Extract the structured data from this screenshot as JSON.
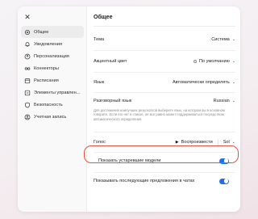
{
  "sidebar": {
    "close_icon": "close-icon",
    "items": [
      {
        "label": "Общее",
        "icon": "gear-icon",
        "active": true
      },
      {
        "label": "Уведомления",
        "icon": "bell-icon"
      },
      {
        "label": "Персонализация",
        "icon": "person-icon"
      },
      {
        "label": "Коннекторы",
        "icon": "connector-icon"
      },
      {
        "label": "Расписания",
        "icon": "calendar-icon"
      },
      {
        "label": "Элементы управлен...",
        "icon": "controls-icon"
      },
      {
        "label": "Безопасность",
        "icon": "shield-icon"
      },
      {
        "label": "Учетная запись",
        "icon": "account-icon"
      }
    ]
  },
  "main": {
    "title": "Общее",
    "theme": {
      "label": "Тема",
      "value": "Система"
    },
    "accent": {
      "label": "Акцентный цвет",
      "value": "По умолчанию"
    },
    "language": {
      "label": "Язык",
      "value": "Автоматически определять"
    },
    "spoken": {
      "label": "Разговорный язык",
      "value": "Russian",
      "description": "Для достижения наилучших результатов выберите язык, на котором вы в основном говорите. Если его нет в списке, он все равно может поддерживаться посредством автоматического определения."
    },
    "voice": {
      "label": "Голос",
      "play_label": "Воспроизвести",
      "value": "Sol"
    },
    "legacy_models": {
      "label": "Показать устаревшие модели",
      "enabled": true
    },
    "followups": {
      "label": "Показывать последующие предложения в чатах",
      "enabled": true
    }
  },
  "colors": {
    "toggle_on": "#1f6feb",
    "highlight": "#e0523c"
  }
}
